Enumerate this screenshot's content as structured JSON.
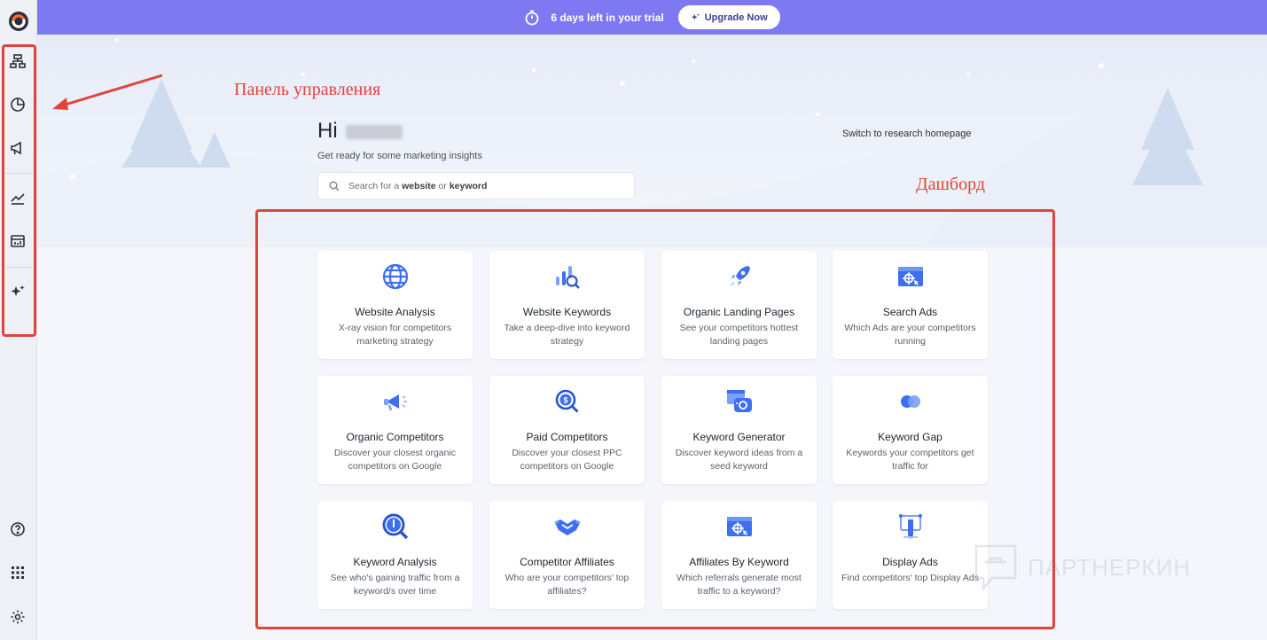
{
  "banner": {
    "trial_text": "6 days left in your trial",
    "upgrade_label": "Upgrade Now"
  },
  "annotations": {
    "sidebar_label": "Панель управления",
    "dashboard_label": "Дашборд"
  },
  "home": {
    "greeting": "Hi",
    "subtitle": "Get ready for some marketing insights",
    "switch_link": "Switch to research homepage",
    "search_placeholder_prefix": "Search for a ",
    "search_placeholder_bold1": "website",
    "search_placeholder_mid": " or ",
    "search_placeholder_bold2": "keyword"
  },
  "sidebar": {
    "items": [
      {
        "icon": "hierarchy-icon"
      },
      {
        "icon": "pie-chart-icon"
      },
      {
        "icon": "megaphone-icon"
      },
      {
        "icon": "trend-line-icon"
      },
      {
        "icon": "dashboard-icon"
      },
      {
        "icon": "sparkle-icon"
      },
      {
        "icon": "help-icon"
      },
      {
        "icon": "apps-grid-icon"
      },
      {
        "icon": "settings-icon"
      }
    ]
  },
  "cards": [
    {
      "title": "Website Analysis",
      "desc": "X-ray vision for competitors marketing strategy",
      "icon": "globe-icon"
    },
    {
      "title": "Website Keywords",
      "desc": "Take a deep-dive into keyword strategy",
      "icon": "keyword-magnifier-icon"
    },
    {
      "title": "Organic Landing Pages",
      "desc": "See your competitors hottest landing pages",
      "icon": "rocket-icon"
    },
    {
      "title": "Search Ads",
      "desc": "Which Ads are your competitors running",
      "icon": "ad-window-icon"
    },
    {
      "title": "Organic Competitors",
      "desc": "Discover your closest organic competitors on Google",
      "icon": "megaphone-icon"
    },
    {
      "title": "Paid Competitors",
      "desc": "Discover your closest PPC competitors on Google",
      "icon": "dollar-search-icon"
    },
    {
      "title": "Keyword Generator",
      "desc": "Discover keyword ideas from a seed keyword",
      "icon": "keyword-generator-icon"
    },
    {
      "title": "Keyword Gap",
      "desc": "Keywords your competitors get traffic for",
      "icon": "venn-icon"
    },
    {
      "title": "Keyword Analysis",
      "desc": "See who's gaining traffic from a keyword/s over time",
      "icon": "magnifier-icon"
    },
    {
      "title": "Competitor Affiliates",
      "desc": "Who are your competitors' top affiliates?",
      "icon": "handshake-icon"
    },
    {
      "title": "Affiliates By Keyword",
      "desc": "Which referrals generate most traffic to a keyword?",
      "icon": "ad-window-icon"
    },
    {
      "title": "Display Ads",
      "desc": "Find competitors' top Display Ads",
      "icon": "display-ads-icon"
    }
  ],
  "watermark": "ПАРТНЕРКИН",
  "colors": {
    "banner": "#7f78f3",
    "accent": "#3d6ff0",
    "annotation": "#e0443a"
  }
}
